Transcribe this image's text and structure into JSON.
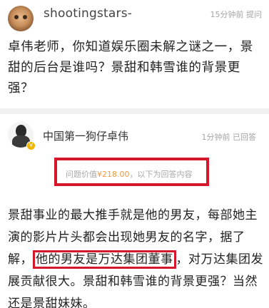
{
  "question": {
    "username": "shootingstars-",
    "meta": "15分钟前 提问",
    "text": "卓伟老师，你知道娱乐圈未解之谜之一，景甜的后台是谁吗？景甜和韩雪谁的背景更强？"
  },
  "answer": {
    "username": "中国第一狗仔卓伟",
    "meta": "1分钟前 已回答",
    "verified_badge": "V",
    "price_prefix": "问题价值",
    "price_amount": "¥218.00",
    "price_suffix": "，以下为回答内容",
    "text_before": "景甜事业的最大推手就是他的男友，每部她主演的影片片头都会出现她男友的名字，据了解，",
    "text_highlight": "他的男友是万达集团董事",
    "text_after": "，对万达集团发展贡献很大。景甜和韩雪谁的背景更强？当然还是景甜妹妹。"
  },
  "colors": {
    "highlight_box": "#d6162a",
    "price_amount": "#f19a3e",
    "verified_badge": "#f0b400",
    "divider": "#f1f1f1"
  },
  "icons": {
    "question_avatar": "cat-avatar",
    "answer_avatar": "person-avatar",
    "verified": "verified-badge-icon"
  }
}
